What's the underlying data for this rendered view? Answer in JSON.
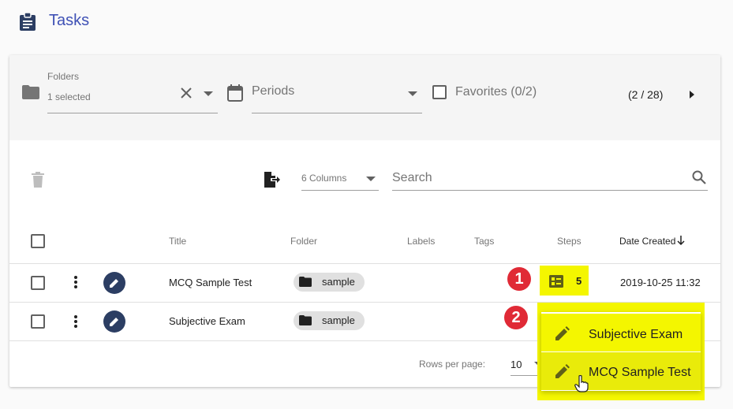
{
  "header": {
    "title": "Tasks",
    "icon": "clipboard-icon"
  },
  "filters": {
    "folders_label": "Folders",
    "folders_value": "1 selected",
    "periods_placeholder": "Periods",
    "favorites_label": "Favorites (0/2)",
    "page_count": "(2 / 28)"
  },
  "toolbar": {
    "columns_value": "6 Columns",
    "search_placeholder": "Search"
  },
  "table": {
    "headers": {
      "title": "Title",
      "folder": "Folder",
      "labels": "Labels",
      "tags": "Tags",
      "steps": "Steps",
      "date_created": "Date Created"
    },
    "rows": [
      {
        "title": "MCQ Sample Test",
        "folder": "sample",
        "steps": "5",
        "date_created": "2019-10-25 11:32"
      },
      {
        "title": "Subjective Exam",
        "folder": "sample",
        "steps": "",
        "date_created": ""
      }
    ]
  },
  "footer": {
    "rows_per_page_label": "Rows per page:",
    "rows_per_page_value": "10"
  },
  "menu": {
    "items": [
      {
        "label": "Subjective Exam"
      },
      {
        "label": "MCQ Sample Test"
      }
    ]
  },
  "annotations": {
    "badge1": "1",
    "badge2": "2"
  },
  "colors": {
    "accent": "#3f51b5",
    "edit_button": "#2c3e63",
    "highlight": "#f4f600",
    "badge": "#e02a36"
  }
}
